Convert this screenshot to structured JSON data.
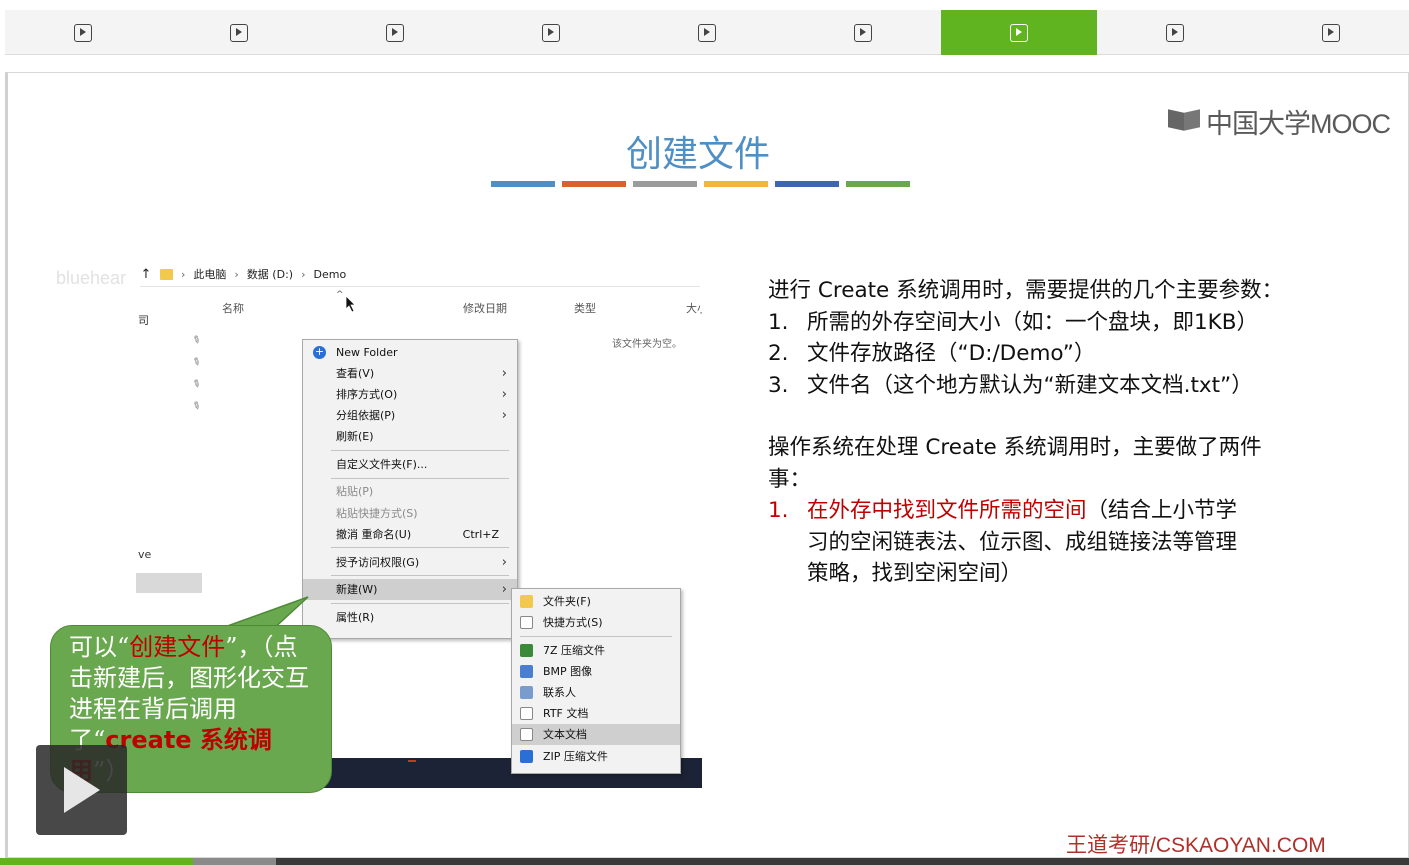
{
  "tabs": [
    {
      "icon": "play-tab-icon",
      "active": false
    },
    {
      "icon": "play-tab-icon",
      "active": false
    },
    {
      "icon": "play-tab-icon",
      "active": false
    },
    {
      "icon": "play-tab-icon",
      "active": false
    },
    {
      "icon": "play-tab-icon",
      "active": false
    },
    {
      "icon": "play-tab-icon",
      "active": false
    },
    {
      "icon": "play-tab-icon",
      "active": true
    },
    {
      "icon": "play-tab-icon",
      "active": false
    },
    {
      "icon": "play-tab-icon",
      "active": false
    }
  ],
  "colors": {
    "accent_green": "#5fb420",
    "title_blue": "#4f8fc3",
    "highlight_red": "#c00000",
    "title_bar": [
      "#4f8fc3",
      "#d9602f",
      "#9b9b9b",
      "#f2b63b",
      "#3f67b0",
      "#6aa84f"
    ]
  },
  "slide": {
    "logo": "中国大学MOOC",
    "title": "创建文件",
    "watermark": "bluehear",
    "footer": "王道考研/CSKAOYAN.COM",
    "explorer": {
      "breadcrumb": [
        "此电脑",
        "数据 (D:)",
        "Demo"
      ],
      "columns": [
        "名称",
        "修改日期",
        "类型",
        "大小"
      ],
      "empty_note": "该文件夹为空。",
      "nav_fragments": [
        "司",
        "ve"
      ],
      "context_menu": {
        "new_folder": "New Folder",
        "view": "查看(V)",
        "sort": "排序方式(O)",
        "group": "分组依据(P)",
        "refresh": "刷新(E)",
        "customize": "自定义文件夹(F)...",
        "paste": "粘贴(P)",
        "paste_shortcut": "粘贴快捷方式(S)",
        "undo": "撤消 重命名(U)",
        "undo_shortcut": "Ctrl+Z",
        "grant": "授予访问权限(G)",
        "new": "新建(W)",
        "properties": "属性(R)"
      },
      "submenu": {
        "folder": "文件夹(F)",
        "shortcut": "快捷方式(S)",
        "zip7": "7Z 压缩文件",
        "bmp": "BMP 图像",
        "contact": "联系人",
        "rtf": "RTF 文档",
        "text": "文本文档",
        "zip": "ZIP 压缩文件"
      }
    },
    "callout": {
      "p1": "可以“",
      "p2": "创建文件",
      "p3": "”，（点击新建后，图形化交互进程在背后调用了“",
      "p4": "create 系统调用",
      "p5": "”）"
    },
    "right_text": {
      "intro": "进行 Create 系统调用时，需要提供的几个主要参数：",
      "params": [
        {
          "num": "1.",
          "text": "所需的外存空间大小（如：一个盘块，即1KB）"
        },
        {
          "num": "2.",
          "text": "文件存放路径（“D:/Demo”）"
        },
        {
          "num": "3.",
          "text": "文件名（这个地方默认为“新建文本文档.txt”）"
        }
      ],
      "work_line1": "操作系统在处理 Create 系统调用时，主要做了两件",
      "work_line2": "事：",
      "step1_num": "1.",
      "step1_red": "在外存中找到文件所需的空间",
      "step1_rest_a": "（结合上小节学",
      "step1_rest_b": "习的空闲链表法、位示图、成组链接法等管理",
      "step1_rest_c": "策略，找到空闲空间）"
    }
  },
  "player": {
    "played_fraction": 0.137,
    "buffered_fraction": 0.196
  }
}
